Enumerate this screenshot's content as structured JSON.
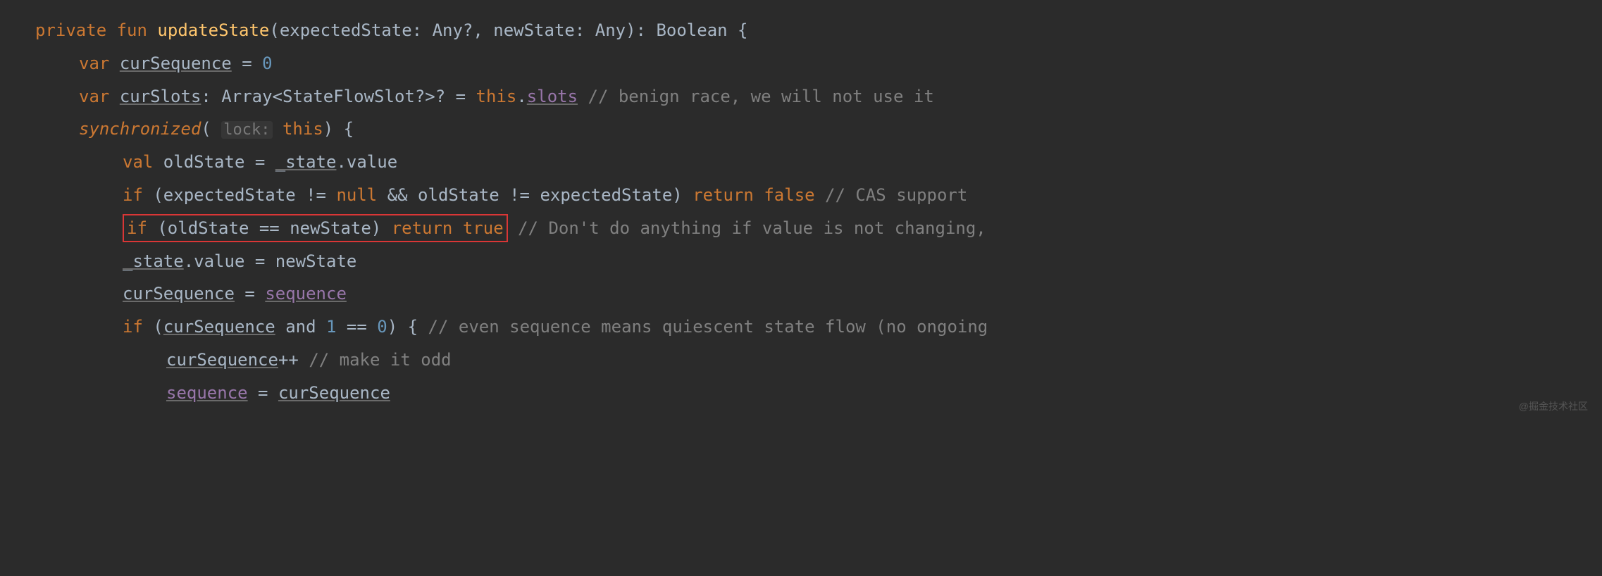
{
  "code": {
    "l1_private": "private",
    "l1_fun": "fun",
    "l1_name": "updateState",
    "l1_sig": "(expectedState: Any?, newState: Any): Boolean {",
    "l2_var": "var",
    "l2_name": "curSequence",
    "l2_eq": " = ",
    "l2_val": "0",
    "l3_var": "var",
    "l3_name": "curSlots",
    "l3_type": ": Array<StateFlowSlot?>? = ",
    "l3_this": "this",
    "l3_dot": ".",
    "l3_slots": "slots",
    "l3_comment": " // benign race, we will not use it",
    "l4_sync": "synchronized",
    "l4_open": "( ",
    "l4_hint": "lock:",
    "l4_this": " this",
    "l4_close": ") {",
    "l5_val": "val",
    "l5_rest1": " oldState = ",
    "l5_state": "_state",
    "l5_rest2": ".value",
    "l6_if": "if",
    "l6_cond1": " (expectedState != ",
    "l6_null": "null",
    "l6_cond2": " && oldState != expectedState) ",
    "l6_return": "return",
    "l6_false": " false",
    "l6_comment": " // CAS support",
    "l7_if": "if",
    "l7_cond": " (oldState == newState) ",
    "l7_return": "return",
    "l7_true": " true",
    "l7_comment": " // Don't do anything if value is not changing,",
    "l8_state": "_state",
    "l8_rest": ".value = newState",
    "l9_left": "curSequence",
    "l9_eq": " = ",
    "l9_right": "sequence",
    "l10_if": "if",
    "l10_open": " (",
    "l10_var": "curSequence",
    "l10_sp": " ",
    "l10_and": "and",
    "l10_sp2": " ",
    "l10_one": "1",
    "l10_eq": " == ",
    "l10_zero": "0",
    "l10_close": ") { ",
    "l10_comment": "// even sequence means quiescent state flow (no ongoing",
    "l11_var": "curSequence",
    "l11_inc": "++ ",
    "l11_comment": "// make it odd",
    "l12_left": "sequence",
    "l12_eq": " = ",
    "l12_right": "curSequence"
  },
  "watermark": "@掘金技术社区"
}
